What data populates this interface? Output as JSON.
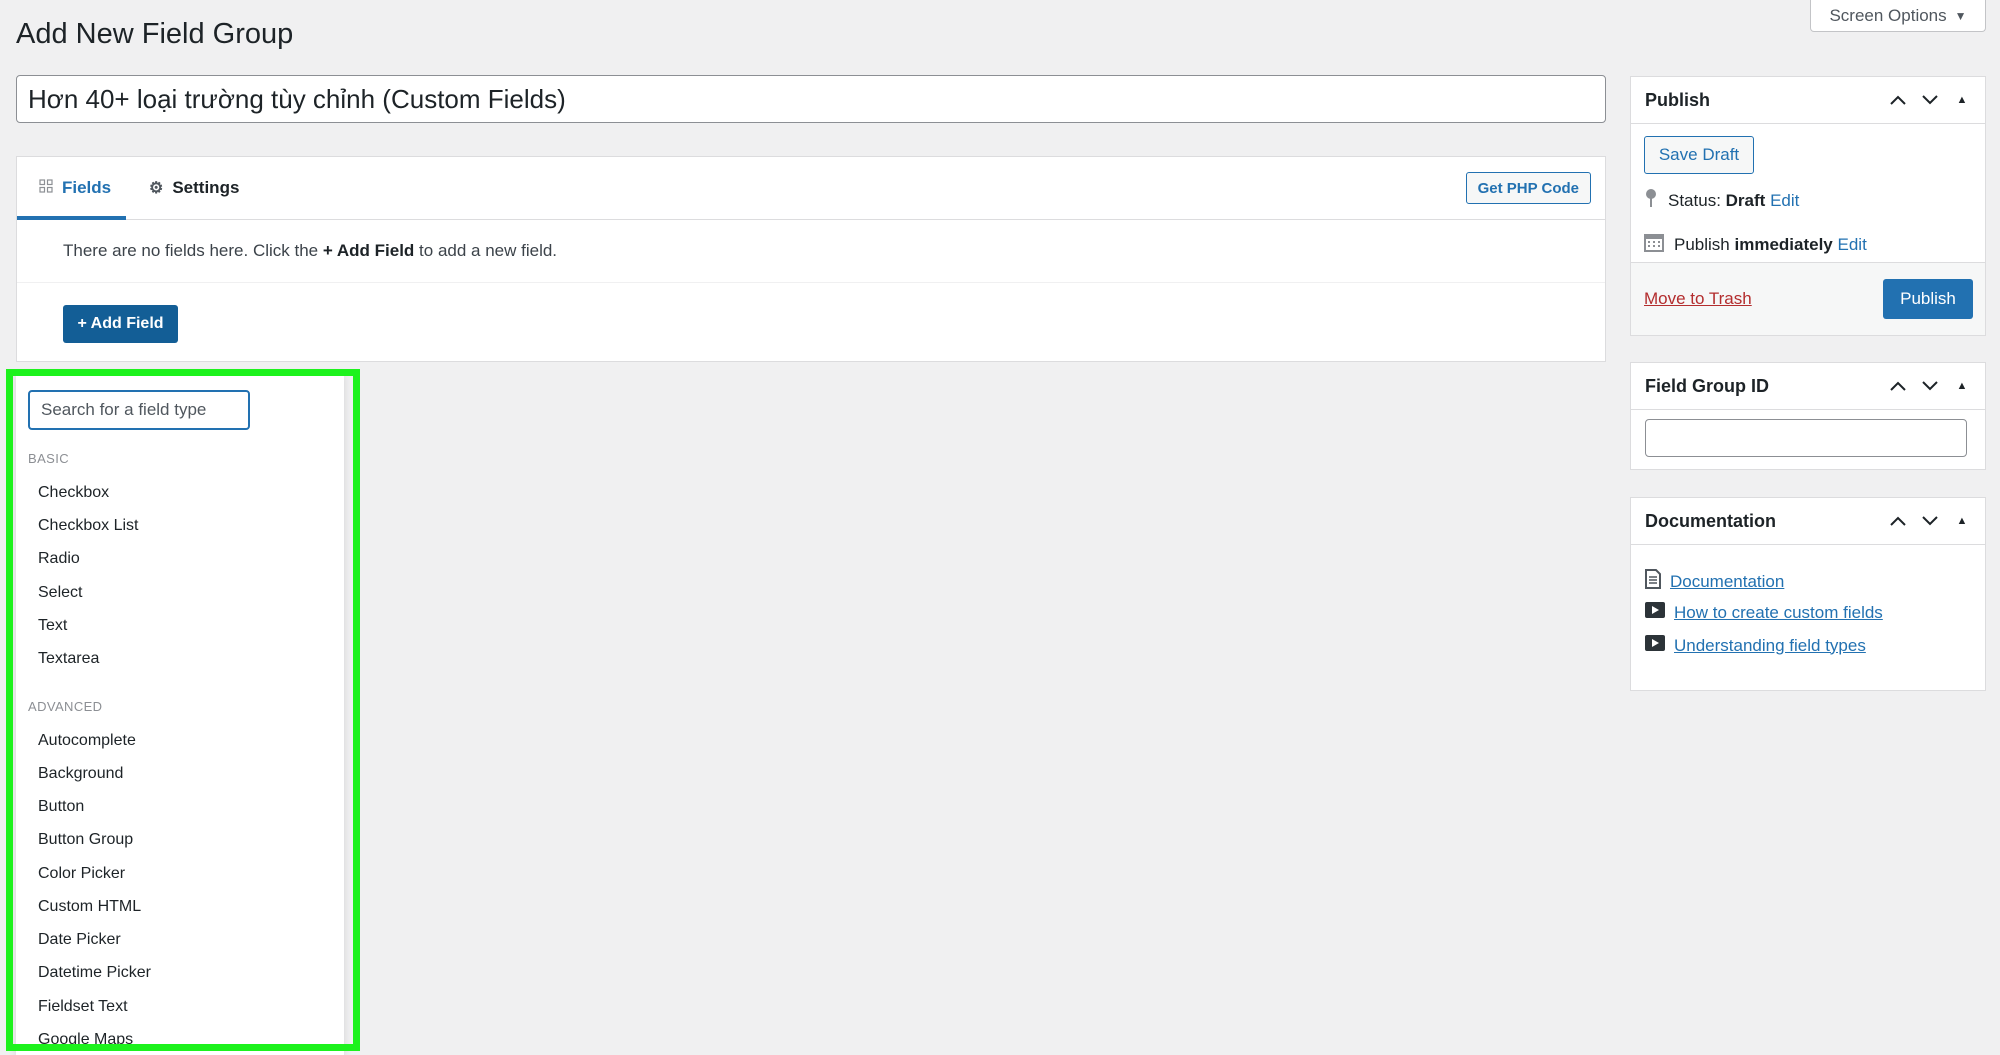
{
  "header": {
    "title": "Add New Field Group",
    "screen_options": "Screen Options"
  },
  "title_field": {
    "value": "Hơn 40+ loại trường tùy chỉnh (Custom Fields)"
  },
  "tabs": [
    {
      "label": "Fields",
      "icon": "grid-icon",
      "active": true
    },
    {
      "label": "Settings",
      "icon": "gear-icon",
      "active": false
    }
  ],
  "php_button": "Get PHP Code",
  "empty_state": {
    "prefix": "There are no fields here. Click the ",
    "emphasis": "+ Add Field",
    "suffix": " to add a new field."
  },
  "add_field_button": "+ Add Field",
  "field_type_menu": {
    "search_placeholder": "Search for a field type",
    "groups": [
      {
        "title": "BASIC",
        "items": [
          "Checkbox",
          "Checkbox List",
          "Radio",
          "Select",
          "Text",
          "Textarea"
        ]
      },
      {
        "title": "ADVANCED",
        "items": [
          "Autocomplete",
          "Background",
          "Button",
          "Button Group",
          "Color Picker",
          "Custom HTML",
          "Date Picker",
          "Datetime Picker",
          "Fieldset Text",
          "Google Maps"
        ]
      }
    ]
  },
  "publish_box": {
    "title": "Publish",
    "save_draft": "Save Draft",
    "status_label": "Status:",
    "status_value": "Draft",
    "status_edit": "Edit",
    "publish_label": "Publish",
    "publish_value": "immediately",
    "publish_edit": "Edit",
    "trash": "Move to Trash",
    "publish_button": "Publish"
  },
  "id_box": {
    "title": "Field Group ID",
    "value": ""
  },
  "doc_box": {
    "title": "Documentation",
    "links": [
      {
        "label": "Documentation",
        "icon": "document-icon"
      },
      {
        "label": "How to create custom fields",
        "icon": "video-icon"
      },
      {
        "label": "Understanding field types",
        "icon": "video-icon"
      }
    ]
  },
  "colors": {
    "accent": "#2271b1",
    "primary_button": "#135e96",
    "danger": "#b32d2e",
    "highlight": "#1df21d",
    "background": "#f0f0f1"
  }
}
